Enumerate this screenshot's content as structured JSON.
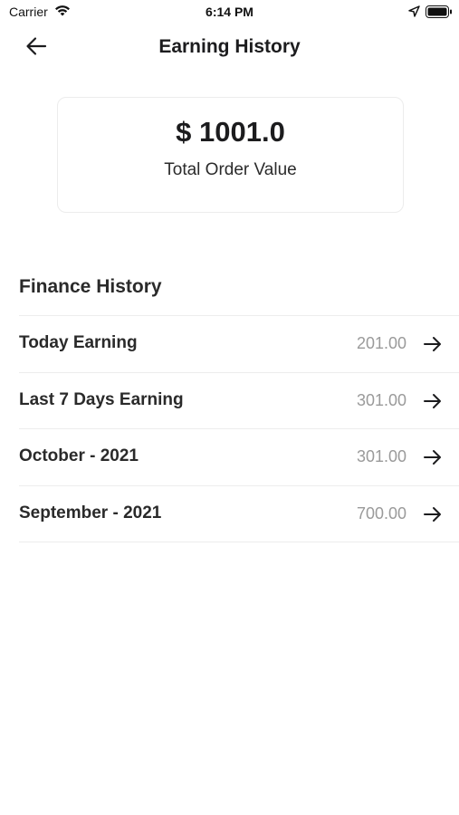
{
  "status_bar": {
    "carrier": "Carrier",
    "time": "6:14 PM",
    "icons": [
      "wifi-icon",
      "location-arrow-icon",
      "battery-icon"
    ]
  },
  "header": {
    "back_icon": "arrow-left-icon",
    "title": "Earning History"
  },
  "summary": {
    "amount": "$ 1001.0",
    "label": "Total Order Value"
  },
  "finance": {
    "title": "Finance History",
    "rows": [
      {
        "label": "Today Earning",
        "value": "201.00"
      },
      {
        "label": "Last 7 Days Earning",
        "value": "301.00"
      },
      {
        "label": "October - 2021",
        "value": "301.00"
      },
      {
        "label": "September - 2021",
        "value": "700.00"
      }
    ],
    "row_icon": "arrow-right-icon"
  },
  "colors": {
    "text": "#1c1c1e",
    "muted_value": "#9a9a9a",
    "divider": "#ededed",
    "card_border": "#ececec",
    "background": "#ffffff"
  }
}
